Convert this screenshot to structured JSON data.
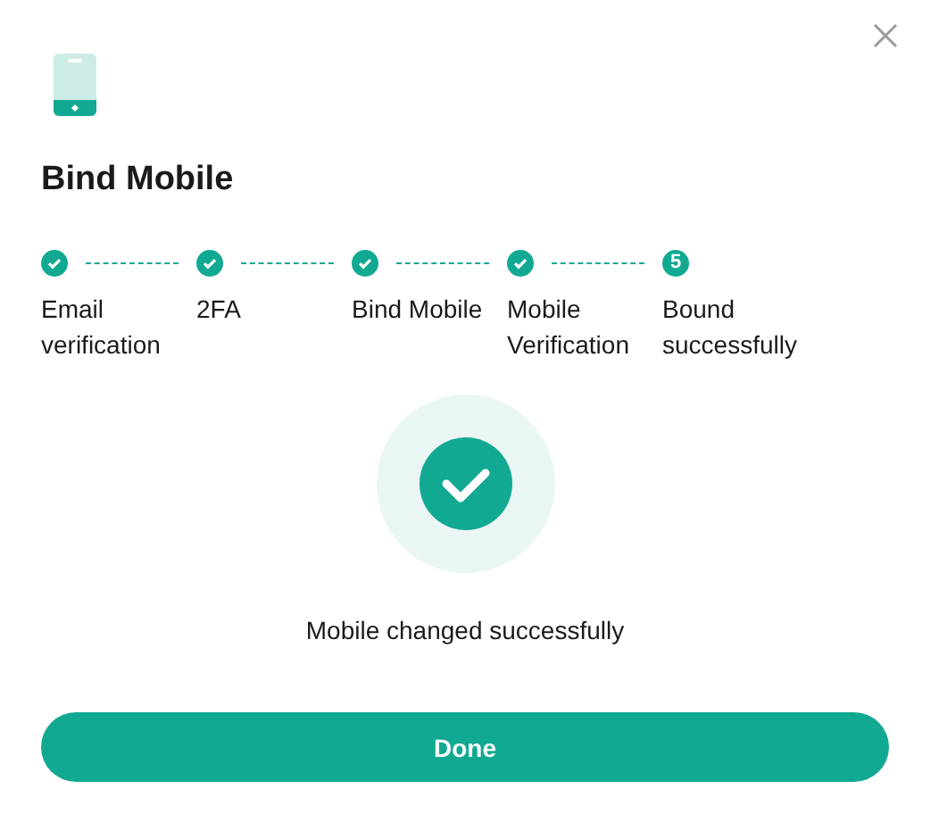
{
  "title": "Bind Mobile",
  "steps": [
    {
      "label": "Email verification",
      "kind": "done"
    },
    {
      "label": "2FA",
      "kind": "done"
    },
    {
      "label": "Bind Mobile",
      "kind": "done"
    },
    {
      "label": "Mobile Verification",
      "kind": "done"
    },
    {
      "label": "Bound successfully",
      "kind": "current",
      "number": "5"
    }
  ],
  "message": "Mobile changed successfully",
  "button": "Done"
}
